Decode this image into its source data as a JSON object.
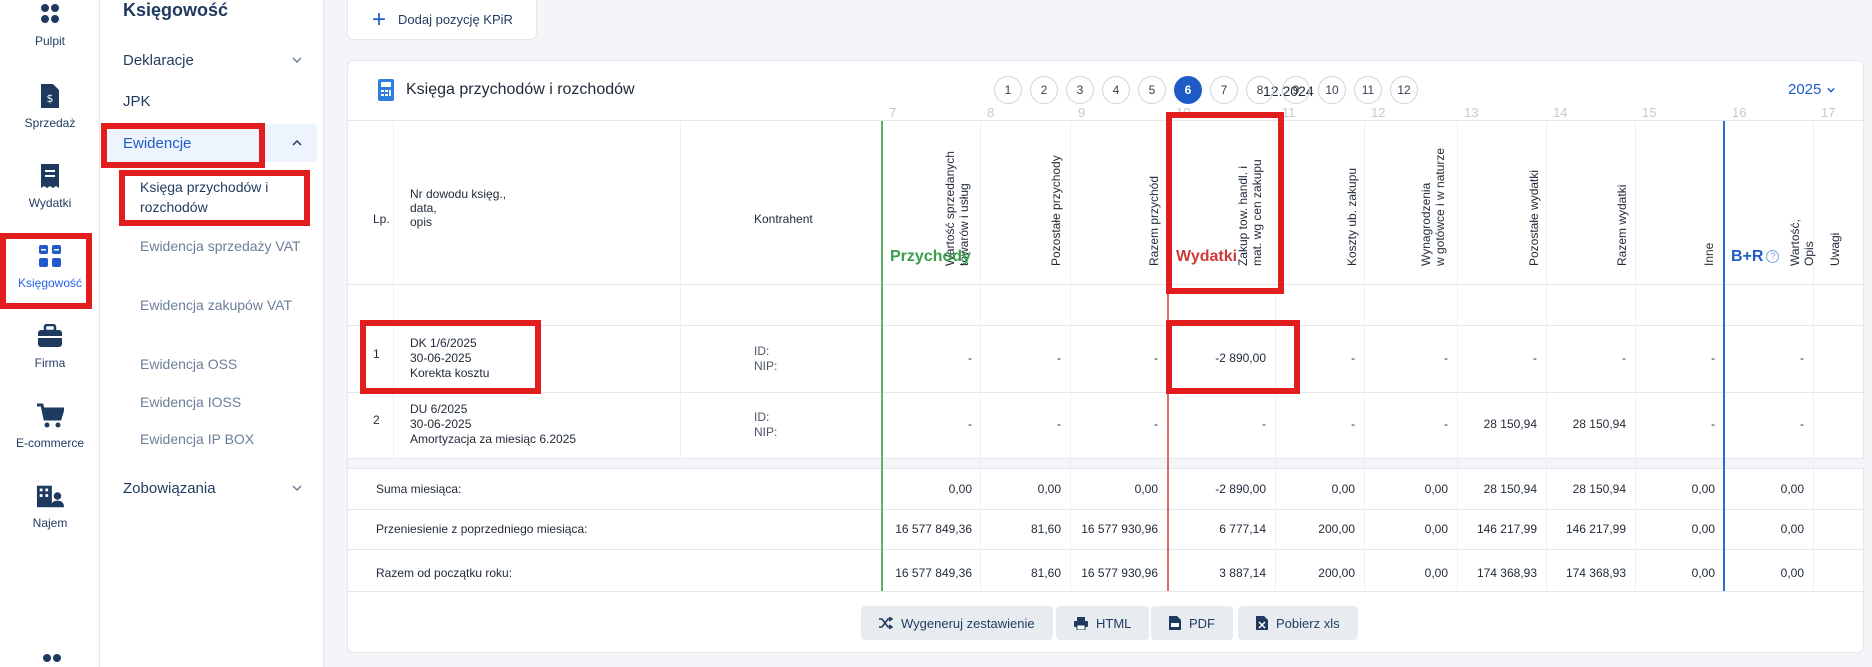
{
  "rail": [
    {
      "label": "Pulpit",
      "icon": "dashboard-icon"
    },
    {
      "label": "Sprzedaż",
      "icon": "invoice-dollar-icon"
    },
    {
      "label": "Wydatki",
      "icon": "receipt-icon"
    },
    {
      "label": "Księgowość",
      "icon": "calculator-icon"
    },
    {
      "label": "Firma",
      "icon": "briefcase-icon"
    },
    {
      "label": "E-commerce",
      "icon": "cart-icon"
    },
    {
      "label": "Najem",
      "icon": "building-person-icon"
    }
  ],
  "subnav": {
    "title": "Księgowość",
    "items": [
      {
        "label": "Deklaracje"
      },
      {
        "label": "JPK"
      },
      {
        "label": "Ewidencje"
      },
      {
        "label": "Zobowiązania"
      }
    ],
    "ewidencje_sub": [
      {
        "label": "Księga przychodów i rozchodów"
      },
      {
        "label": "Ewidencja sprzedaży VAT"
      },
      {
        "label": "Ewidencja zakupów VAT"
      },
      {
        "label": "Ewidencja OSS"
      },
      {
        "label": "Ewidencja IOSS"
      },
      {
        "label": "Ewidencja IP BOX"
      }
    ]
  },
  "add_button": "Dodaj pozycję KPiR",
  "card": {
    "title": "Księga przychodów i rozchodów",
    "period": "12.2024",
    "months": [
      "1",
      "2",
      "3",
      "4",
      "5",
      "6",
      "7",
      "8",
      "9",
      "10",
      "11",
      "12"
    ],
    "active_month": "6",
    "year": "2025"
  },
  "table": {
    "col_numbers": [
      "7",
      "8",
      "9",
      "10",
      "11",
      "12",
      "13",
      "14",
      "15",
      "16",
      "17"
    ],
    "hdr_lp": "Lp.",
    "hdr_doc": "Nr dowodu księg.,\ndata,\nopis",
    "hdr_kontrahent": "Kontrahent",
    "rot_headers": [
      "Wartość sprzedanych\ntowarów i usług",
      "Pozostałe przychody",
      "Razem przychód",
      "Zakup tow. handl. i\nmat. wg cen zakupu",
      "Koszty ub. zakupu",
      "Wynagrodzenia\nw gotówce i w naturze",
      "Pozostałe wydatki",
      "Razem wydatki",
      "Inne",
      "Wartość,\nOpis",
      "Uwagi"
    ],
    "section_income": "Przychody",
    "section_expense": "Wydatki",
    "section_br": "B+R",
    "rows": [
      {
        "lp": "1",
        "doc": "DK 1/6/2025",
        "date": "30-06-2025",
        "desc": "Korekta kosztu",
        "id": "ID:",
        "nip": "NIP:",
        "values": [
          "-",
          "-",
          "-",
          "-2 890,00",
          "-",
          "-",
          "-",
          "-",
          "-",
          "-"
        ]
      },
      {
        "lp": "2",
        "doc": "DU 6/2025",
        "date": "30-06-2025",
        "desc": "Amortyzacja za miesiąc 6.2025",
        "id": "ID:",
        "nip": "NIP:",
        "values": [
          "-",
          "-",
          "-",
          "-",
          "-",
          "-",
          "28 150,94",
          "28 150,94",
          "-",
          "-"
        ]
      }
    ],
    "summaries": [
      {
        "label": "Suma miesiąca:",
        "values": [
          "0,00",
          "0,00",
          "0,00",
          "-2 890,00",
          "0,00",
          "0,00",
          "28 150,94",
          "28 150,94",
          "0,00",
          "0,00"
        ]
      },
      {
        "label": "Przeniesienie z poprzedniego miesiąca:",
        "values": [
          "16 577 849,36",
          "81,60",
          "16 577 930,96",
          "6 777,14",
          "200,00",
          "0,00",
          "146 217,99",
          "146 217,99",
          "0,00",
          "0,00"
        ]
      },
      {
        "label": "Razem od początku roku:",
        "values": [
          "16 577 849,36",
          "81,60",
          "16 577 930,96",
          "3 887,14",
          "200,00",
          "0,00",
          "174 368,93",
          "174 368,93",
          "0,00",
          "0,00"
        ]
      }
    ]
  },
  "bottom_buttons": [
    {
      "label": "Wygeneruj zestawienie",
      "icon": "shuffle-icon"
    },
    {
      "label": "HTML",
      "icon": "printer-icon"
    },
    {
      "label": "PDF",
      "icon": "pdf-file-icon"
    },
    {
      "label": "Pobierz xls",
      "icon": "xls-file-icon"
    }
  ],
  "colors": {
    "accent": "#1e5bc6",
    "income": "#3aa04a",
    "expense": "#d03a3a",
    "highlight": "#e11d1d"
  }
}
